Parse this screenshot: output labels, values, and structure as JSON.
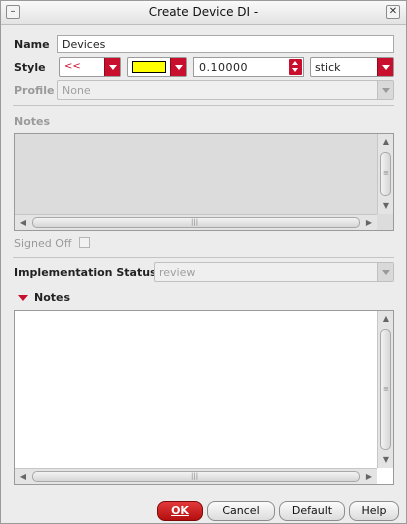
{
  "window": {
    "title": "Create Device DI -"
  },
  "fields": {
    "name_label": "Name",
    "name_value": "Devices",
    "style_label": "Style",
    "line_style_glyph": "<<",
    "fill_color": "#ffff00",
    "width_value": "0.10000",
    "line_type_value": "stick",
    "profile_label": "Profile",
    "profile_value": "None",
    "notes_label": "Notes",
    "signed_off_label": "Signed Off",
    "impl_status_label": "Implementation Status",
    "impl_status_value": "review",
    "notes2_label": "Notes"
  },
  "buttons": {
    "ok": "OK",
    "cancel": "Cancel",
    "default": "Default",
    "help": "Help"
  },
  "colors": {
    "accent": "#c8102e",
    "textarea_disabled_bg": "#dcdcdc"
  }
}
